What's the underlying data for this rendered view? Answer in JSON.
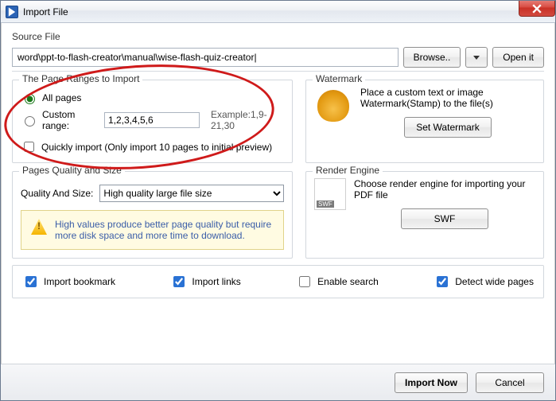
{
  "window": {
    "title": "Import File"
  },
  "source": {
    "label": "Source File",
    "path": "word\\ppt-to-flash-creator\\manual\\wise-flash-quiz-creator|",
    "browse": "Browse..",
    "open": "Open it"
  },
  "ranges": {
    "title": "The Page Ranges to Import",
    "all_label": "All pages",
    "custom_label": "Custom range:",
    "custom_value": "1,2,3,4,5,6",
    "example": "Example:1,9-21,30",
    "quick_label": "Quickly import (Only import 10 pages to  initial  preview)"
  },
  "watermark": {
    "title": "Watermark",
    "desc": "Place a custom text or image Watermark(Stamp) to the file(s)",
    "btn": "Set Watermark"
  },
  "quality": {
    "title": "Pages Quality and Size",
    "label": "Quality And Size:",
    "selected": "High quality large file size",
    "info": "High values produce better page quality but require more disk space and more time to download."
  },
  "render": {
    "title": "Render Engine",
    "desc": "Choose render engine for importing your PDF file",
    "btn": "SWF",
    "icon_tag": "SWF"
  },
  "options": {
    "bookmark": "Import bookmark",
    "links": "Import links",
    "search": "Enable search",
    "wide": "Detect wide pages"
  },
  "footer": {
    "import": "Import Now",
    "cancel": "Cancel"
  }
}
